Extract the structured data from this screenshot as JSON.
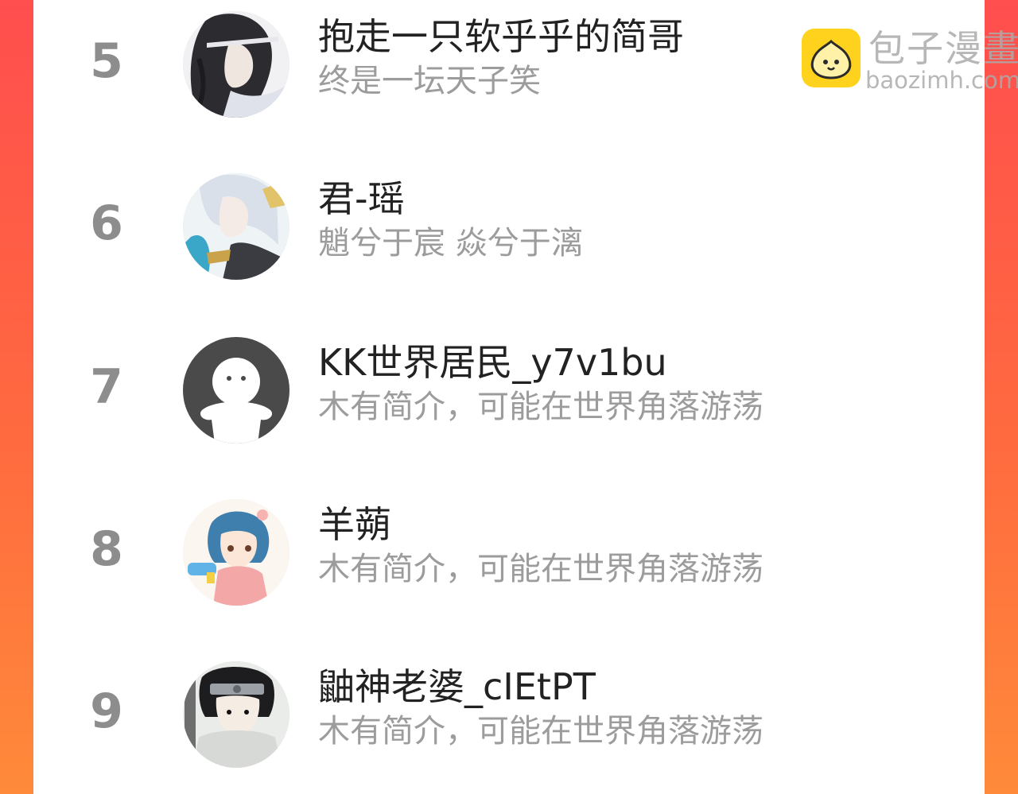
{
  "watermark": {
    "name": "包子漫畫",
    "url": "baozimh.com",
    "brand_color": "#ffd21e"
  },
  "rows": [
    {
      "rank": "5",
      "name": "抱走一只软乎乎的简哥",
      "bio": "终是一坛天子笑",
      "avatar": "ink-hair-character-avatar"
    },
    {
      "rank": "6",
      "name": "君-瑶",
      "bio": "魈兮于宸 焱兮于漓",
      "avatar": "white-hair-character-avatar"
    },
    {
      "rank": "7",
      "name": "KK世界居民_y7v1bu",
      "bio": "木有简介，可能在世界角落游荡",
      "avatar": "default-ghost-avatar"
    },
    {
      "rank": "8",
      "name": "羊蒴",
      "bio": "木有简介，可能在世界角落游荡",
      "avatar": "blue-hair-girl-avatar"
    },
    {
      "rank": "9",
      "name": "鼬神老婆_cIEtPT",
      "bio": "木有简介，可能在世界角落游荡",
      "avatar": "ninja-character-avatar"
    }
  ]
}
